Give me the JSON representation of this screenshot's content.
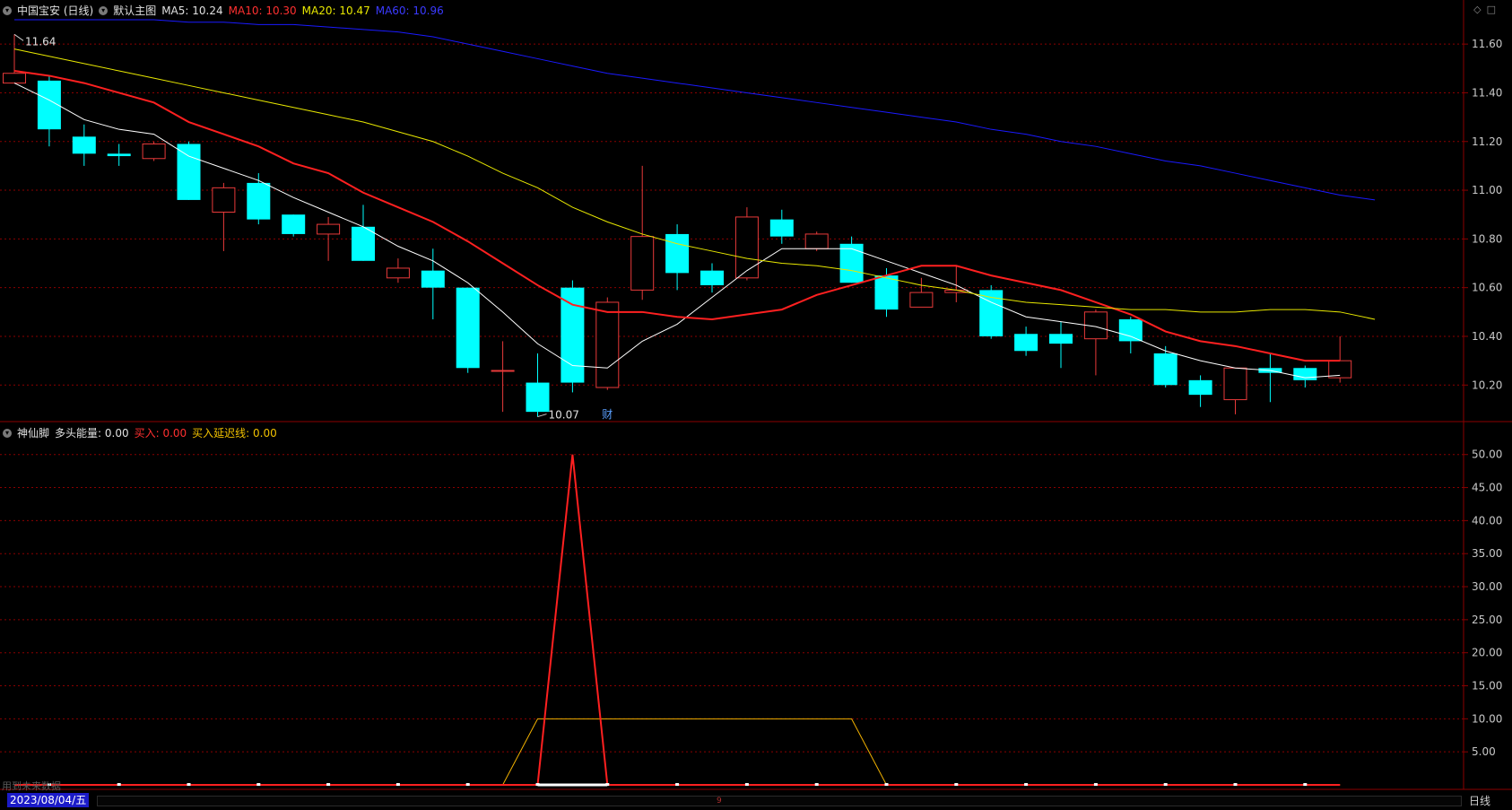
{
  "main_header": {
    "stock_name": "中国宝安 (日线)",
    "template": "默认主图",
    "ma5_label": "MA5: 10.24",
    "ma10_label": "MA10: 10.30",
    "ma20_label": "MA20: 10.47",
    "ma60_label": "MA60: 10.96"
  },
  "sub_header": {
    "indicator": "神仙脚",
    "bull_energy_label": "多头能量: 0.00",
    "buy_label": "买入: 0.00",
    "buy_delay_label": "买入延迟线: 0.00"
  },
  "footer": {
    "date": "2023/08/04/五",
    "period": "日线",
    "no_data": "用到未来数据",
    "scroll_marker": "9"
  },
  "colors": {
    "up": "#e83a3a",
    "down": "#00ffff",
    "ma5": "#ffffff",
    "ma10": "#ff2020",
    "ma20": "#e8e800",
    "ma60": "#1a1aff",
    "grid": "#8b0000",
    "axis_text": "#c8c8c8"
  },
  "chart_data": [
    {
      "type": "candlestick",
      "title": "中国宝安 (日线)",
      "ylim": [
        10.05,
        11.7
      ],
      "yticks": [
        10.2,
        10.4,
        10.6,
        10.8,
        11.0,
        11.2,
        11.4,
        11.6
      ],
      "ytick_labels": [
        "10.20",
        "10.40",
        "10.60",
        "10.80",
        "11.00",
        "11.20",
        "11.40",
        "11.60"
      ],
      "annotations": [
        {
          "text": "11.64",
          "candle": 0,
          "value": 11.64
        },
        {
          "text": "10.07",
          "candle": 15,
          "value": 10.07
        },
        {
          "text": "财",
          "candle": 17,
          "value": 10.05
        }
      ],
      "candles": [
        {
          "o": 11.44,
          "h": 11.64,
          "l": 11.44,
          "c": 11.48
        },
        {
          "o": 11.45,
          "h": 11.47,
          "l": 11.18,
          "c": 11.25
        },
        {
          "o": 11.22,
          "h": 11.27,
          "l": 11.1,
          "c": 11.15
        },
        {
          "o": 11.15,
          "h": 11.19,
          "l": 11.1,
          "c": 11.14
        },
        {
          "o": 11.13,
          "h": 11.2,
          "l": 11.12,
          "c": 11.19
        },
        {
          "o": 11.19,
          "h": 11.2,
          "l": 10.96,
          "c": 10.96
        },
        {
          "o": 10.91,
          "h": 11.03,
          "l": 10.75,
          "c": 11.01
        },
        {
          "o": 11.03,
          "h": 11.07,
          "l": 10.86,
          "c": 10.88
        },
        {
          "o": 10.9,
          "h": 10.9,
          "l": 10.81,
          "c": 10.82
        },
        {
          "o": 10.82,
          "h": 10.89,
          "l": 10.71,
          "c": 10.86
        },
        {
          "o": 10.85,
          "h": 10.94,
          "l": 10.71,
          "c": 10.71
        },
        {
          "o": 10.64,
          "h": 10.72,
          "l": 10.62,
          "c": 10.68
        },
        {
          "o": 10.67,
          "h": 10.76,
          "l": 10.47,
          "c": 10.6
        },
        {
          "o": 10.6,
          "h": 10.6,
          "l": 10.25,
          "c": 10.27
        },
        {
          "o": 10.26,
          "h": 10.38,
          "l": 10.09,
          "c": 10.26
        },
        {
          "o": 10.21,
          "h": 10.33,
          "l": 10.07,
          "c": 10.09
        },
        {
          "o": 10.6,
          "h": 10.63,
          "l": 10.17,
          "c": 10.21
        },
        {
          "o": 10.19,
          "h": 10.56,
          "l": 10.18,
          "c": 10.54
        },
        {
          "o": 10.59,
          "h": 11.1,
          "l": 10.55,
          "c": 10.81
        },
        {
          "o": 10.82,
          "h": 10.86,
          "l": 10.59,
          "c": 10.66
        },
        {
          "o": 10.67,
          "h": 10.7,
          "l": 10.58,
          "c": 10.61
        },
        {
          "o": 10.64,
          "h": 10.93,
          "l": 10.63,
          "c": 10.89
        },
        {
          "o": 10.88,
          "h": 10.92,
          "l": 10.78,
          "c": 10.81
        },
        {
          "o": 10.76,
          "h": 10.83,
          "l": 10.75,
          "c": 10.82
        },
        {
          "o": 10.78,
          "h": 10.81,
          "l": 10.62,
          "c": 10.62
        },
        {
          "o": 10.65,
          "h": 10.68,
          "l": 10.48,
          "c": 10.51
        },
        {
          "o": 10.52,
          "h": 10.64,
          "l": 10.52,
          "c": 10.58
        },
        {
          "o": 10.58,
          "h": 10.69,
          "l": 10.54,
          "c": 10.59
        },
        {
          "o": 10.59,
          "h": 10.61,
          "l": 10.39,
          "c": 10.4
        },
        {
          "o": 10.41,
          "h": 10.44,
          "l": 10.32,
          "c": 10.34
        },
        {
          "o": 10.41,
          "h": 10.46,
          "l": 10.27,
          "c": 10.37
        },
        {
          "o": 10.39,
          "h": 10.51,
          "l": 10.24,
          "c": 10.5
        },
        {
          "o": 10.47,
          "h": 10.48,
          "l": 10.33,
          "c": 10.38
        },
        {
          "o": 10.33,
          "h": 10.36,
          "l": 10.19,
          "c": 10.2
        },
        {
          "o": 10.22,
          "h": 10.24,
          "l": 10.11,
          "c": 10.16
        },
        {
          "o": 10.14,
          "h": 10.27,
          "l": 10.08,
          "c": 10.27
        },
        {
          "o": 10.27,
          "h": 10.33,
          "l": 10.13,
          "c": 10.25
        },
        {
          "o": 10.27,
          "h": 10.28,
          "l": 10.19,
          "c": 10.22
        },
        {
          "o": 10.23,
          "h": 10.4,
          "l": 10.21,
          "c": 10.3
        }
      ],
      "series": [
        {
          "name": "MA5",
          "values": [
            11.44,
            11.37,
            11.29,
            11.25,
            11.23,
            11.14,
            11.09,
            11.04,
            10.97,
            10.91,
            10.85,
            10.77,
            10.71,
            10.62,
            10.5,
            10.37,
            10.28,
            10.27,
            10.38,
            10.45,
            10.56,
            10.67,
            10.76,
            10.76,
            10.76,
            10.71,
            10.66,
            10.61,
            10.54,
            10.48,
            10.46,
            10.44,
            10.4,
            10.34,
            10.3,
            10.27,
            10.26,
            10.23,
            10.24
          ]
        },
        {
          "name": "MA10",
          "values": [
            11.49,
            11.47,
            11.44,
            11.4,
            11.36,
            11.28,
            11.23,
            11.18,
            11.11,
            11.07,
            10.99,
            10.93,
            10.87,
            10.79,
            10.7,
            10.61,
            10.53,
            10.5,
            10.5,
            10.48,
            10.47,
            10.49,
            10.51,
            10.57,
            10.61,
            10.65,
            10.69,
            10.69,
            10.65,
            10.62,
            10.59,
            10.54,
            10.49,
            10.42,
            10.38,
            10.36,
            10.33,
            10.3,
            10.3
          ]
        },
        {
          "name": "MA20",
          "values": [
            11.58,
            11.55,
            11.52,
            11.49,
            11.46,
            11.43,
            11.4,
            11.37,
            11.34,
            11.31,
            11.28,
            11.24,
            11.2,
            11.14,
            11.07,
            11.01,
            10.93,
            10.87,
            10.82,
            10.78,
            10.75,
            10.72,
            10.7,
            10.69,
            10.67,
            10.64,
            10.61,
            10.59,
            10.56,
            10.54,
            10.53,
            10.52,
            10.51,
            10.51,
            10.5,
            10.5,
            10.51,
            10.51,
            10.5,
            10.47
          ]
        },
        {
          "name": "MA60",
          "values": [
            11.7,
            11.7,
            11.7,
            11.7,
            11.7,
            11.69,
            11.69,
            11.68,
            11.68,
            11.67,
            11.66,
            11.65,
            11.63,
            11.6,
            11.57,
            11.54,
            11.51,
            11.48,
            11.46,
            11.44,
            11.42,
            11.4,
            11.38,
            11.36,
            11.34,
            11.32,
            11.3,
            11.28,
            11.25,
            11.23,
            11.2,
            11.18,
            11.15,
            11.12,
            11.1,
            11.07,
            11.04,
            11.01,
            10.98,
            10.96
          ]
        }
      ]
    },
    {
      "type": "line",
      "title": "神仙脚",
      "ylim": [
        0,
        52
      ],
      "yticks": [
        5,
        10,
        15,
        20,
        25,
        30,
        35,
        40,
        45,
        50
      ],
      "ytick_labels": [
        "5.00",
        "10.00",
        "15.00",
        "20.00",
        "25.00",
        "30.00",
        "35.00",
        "40.00",
        "45.00",
        "50.00"
      ],
      "series": [
        {
          "name": "买入",
          "values": [
            0,
            0,
            0,
            0,
            0,
            0,
            0,
            0,
            0,
            0,
            0,
            0,
            0,
            0,
            0,
            0,
            50,
            0,
            0,
            0,
            0,
            0,
            0,
            0,
            0,
            0,
            0,
            0,
            0,
            0,
            0,
            0,
            0,
            0,
            0,
            0,
            0,
            0,
            0
          ]
        },
        {
          "name": "买入延迟线",
          "values": [
            0,
            0,
            0,
            0,
            0,
            0,
            0,
            0,
            0,
            0,
            0,
            0,
            0,
            0,
            0,
            10,
            10,
            10,
            10,
            10,
            10,
            10,
            10,
            10,
            10,
            0,
            0,
            0,
            0,
            0,
            0,
            0,
            0,
            0,
            0,
            0,
            0,
            0,
            0
          ]
        },
        {
          "name": "多头能量",
          "values": [
            0,
            0,
            0,
            0,
            0,
            0,
            0,
            0,
            0,
            0,
            0,
            0,
            0,
            0,
            0,
            0,
            0,
            0,
            0,
            0,
            0,
            0,
            0,
            0,
            0,
            0,
            0,
            0,
            0,
            0,
            0,
            0,
            0,
            0,
            0,
            0,
            0,
            0,
            0
          ]
        }
      ]
    }
  ]
}
